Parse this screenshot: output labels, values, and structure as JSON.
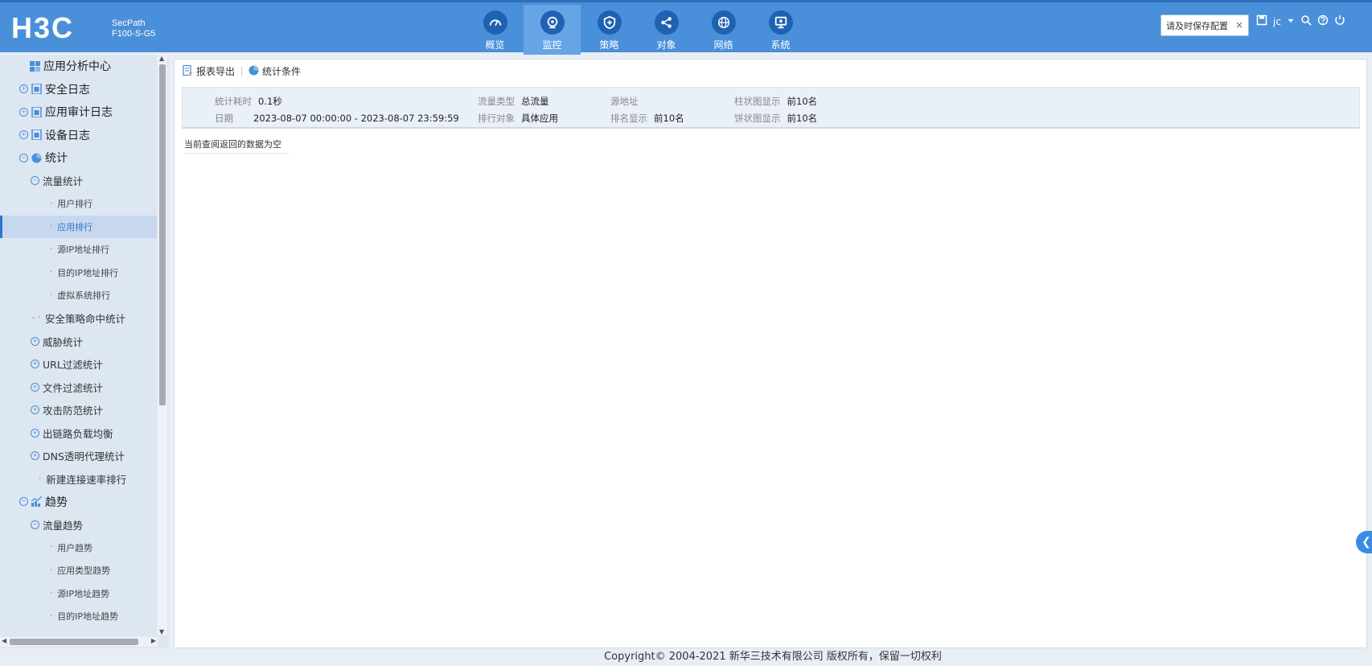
{
  "header": {
    "logo": "H3C",
    "product_line1": "SecPath",
    "product_line2": "F100-S-G5",
    "nav": [
      {
        "label": "概览",
        "icon": "dashboard-icon"
      },
      {
        "label": "监控",
        "icon": "monitor-icon",
        "active": true
      },
      {
        "label": "策略",
        "icon": "shield-icon"
      },
      {
        "label": "对象",
        "icon": "share-icon"
      },
      {
        "label": "网络",
        "icon": "globe-icon"
      },
      {
        "label": "系统",
        "icon": "system-icon"
      }
    ],
    "save_prompt": "请及时保存配置",
    "save_close": "×",
    "user": "jc"
  },
  "sidebar": {
    "items": [
      {
        "label": "应用分析中心",
        "level": 1,
        "icon": "app-analysis-icon"
      },
      {
        "label": "安全日志",
        "level": 1,
        "icon": "log-icon",
        "expander": true
      },
      {
        "label": "应用审计日志",
        "level": 1,
        "icon": "log-icon",
        "expander": true
      },
      {
        "label": "设备日志",
        "level": 1,
        "icon": "log-icon",
        "expander": true
      },
      {
        "label": "统计",
        "level": 1,
        "icon": "pie-icon",
        "expander": true
      },
      {
        "label": "流量统计",
        "level": 2,
        "expander": true
      },
      {
        "label": "用户排行",
        "level": 3
      },
      {
        "label": "应用排行",
        "level": 3,
        "selected": true
      },
      {
        "label": "源IP地址排行",
        "level": 3
      },
      {
        "label": "目的IP地址排行",
        "level": 3
      },
      {
        "label": "虚拟系统排行",
        "level": 3
      },
      {
        "label": "安全策略命中统计",
        "level": 2
      },
      {
        "label": "威胁统计",
        "level": 2,
        "expander": true
      },
      {
        "label": "URL过滤统计",
        "level": 2,
        "expander": true
      },
      {
        "label": "文件过滤统计",
        "level": 2,
        "expander": true
      },
      {
        "label": "攻击防范统计",
        "level": 2,
        "expander": true
      },
      {
        "label": "出链路负载均衡",
        "level": 2,
        "expander": true
      },
      {
        "label": "DNS透明代理统计",
        "level": 2,
        "expander": true
      },
      {
        "label": "新建连接速率排行",
        "level": 2
      },
      {
        "label": "趋势",
        "level": 1,
        "icon": "trend-icon",
        "expander": true
      },
      {
        "label": "流量趋势",
        "level": 2,
        "expander": true
      },
      {
        "label": "用户趋势",
        "level": 3
      },
      {
        "label": "应用类型趋势",
        "level": 3
      },
      {
        "label": "源IP地址趋势",
        "level": 3
      },
      {
        "label": "目的IP地址趋势",
        "level": 3
      }
    ]
  },
  "toolbar": {
    "export_label": "报表导出",
    "conditions_label": "统计条件"
  },
  "conditions": {
    "elapsed_label": "统计耗时",
    "elapsed_value": "0.1秒",
    "traffic_type_label": "流量类型",
    "traffic_type_value": "总流量",
    "source_label": "源地址",
    "source_value": "",
    "bar_display_label": "柱状图显示",
    "bar_display_value": "前10名",
    "date_label": "日期",
    "date_value": "2023-08-07 00:00:00 - 2023-08-07 23:59:59",
    "rank_object_label": "排行对象",
    "rank_object_value": "具体应用",
    "rank_display_label": "排名显示",
    "rank_display_value": "前10名",
    "pie_display_label": "饼状图显示",
    "pie_display_value": "前10名"
  },
  "empty_message": "当前查阅返回的数据为空",
  "footer": "Copyright© 2004-2021 新华三技术有限公司 版权所有，保留一切权利",
  "colors": {
    "brand": "#4a8fd9",
    "nav_icon_bg": "#1f62b3",
    "selected": "#2f74d0"
  }
}
